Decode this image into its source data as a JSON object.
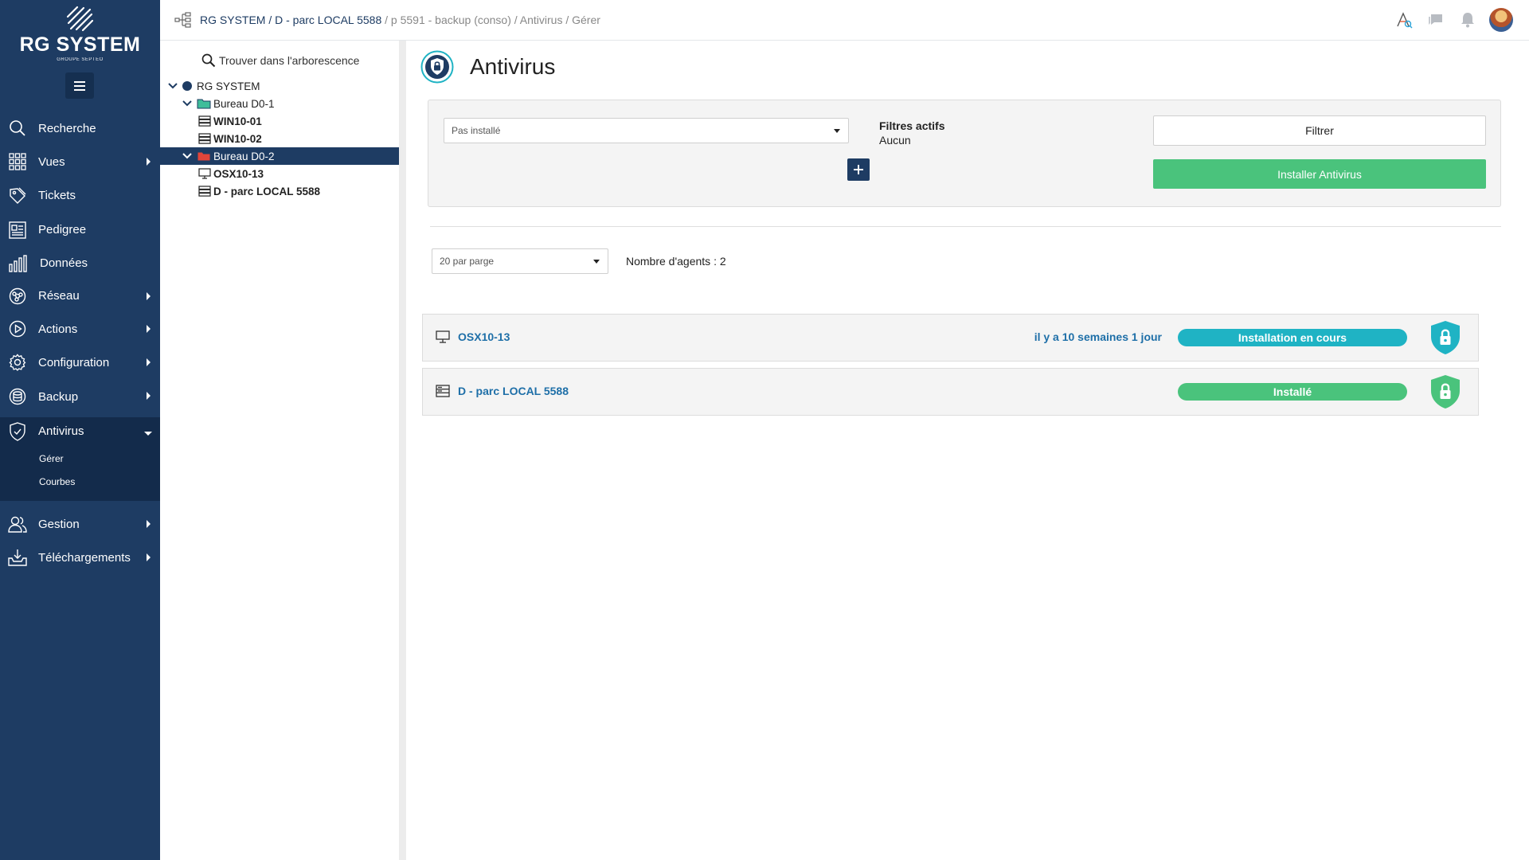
{
  "app": {
    "logo_text": "RG SYSTEM",
    "logo_sub": "GROUPE SEPTEO"
  },
  "sidebar": {
    "items": [
      {
        "label": "Recherche",
        "icon": "search-icon",
        "has_caret": false
      },
      {
        "label": "Vues",
        "icon": "grid-icon",
        "has_caret": true
      },
      {
        "label": "Tickets",
        "icon": "tag-icon",
        "has_caret": false
      },
      {
        "label": "Pedigree",
        "icon": "id-card-icon",
        "has_caret": false
      },
      {
        "label": "Données",
        "icon": "bar-chart-icon",
        "has_caret": false
      },
      {
        "label": "Réseau",
        "icon": "network-icon",
        "has_caret": true
      },
      {
        "label": "Actions",
        "icon": "play-icon",
        "has_caret": true
      },
      {
        "label": "Configuration",
        "icon": "gear-icon",
        "has_caret": true
      },
      {
        "label": "Backup",
        "icon": "database-icon",
        "has_caret": true
      },
      {
        "label": "Antivirus",
        "icon": "shield-check-icon",
        "has_caret": true,
        "active": true
      },
      {
        "label": "Gestion",
        "icon": "users-icon",
        "has_caret": true
      },
      {
        "label": "Téléchargements",
        "icon": "download-tray-icon",
        "has_caret": true
      }
    ],
    "antivirus_sub": [
      "Gérer",
      "Courbes"
    ]
  },
  "breadcrumb": {
    "part1": "RG SYSTEM / D - parc LOCAL 5588",
    "part2": " / p 5591 - backup (conso) / Antivirus / Gérer"
  },
  "tree": {
    "search_label": "Trouver dans l'arborescence",
    "nodes": [
      {
        "label": "RG SYSTEM",
        "depth": 0,
        "type": "root",
        "expanded": true
      },
      {
        "label": "Bureau D0-1",
        "depth": 1,
        "type": "folder-green",
        "expanded": true
      },
      {
        "label": "WIN10-01",
        "depth": 2,
        "type": "server"
      },
      {
        "label": "WIN10-02",
        "depth": 2,
        "type": "server"
      },
      {
        "label": "Bureau D0-2",
        "depth": 1,
        "type": "folder-red",
        "expanded": true,
        "selected": true
      },
      {
        "label": "OSX10-13",
        "depth": 2,
        "type": "monitor"
      },
      {
        "label": "D - parc LOCAL 5588",
        "depth": 2,
        "type": "server"
      }
    ]
  },
  "main": {
    "title": "Antivirus",
    "filter_select": "Pas installé",
    "active_filters_title": "Filtres actifs",
    "active_filters_value": "Aucun",
    "filter_button": "Filtrer",
    "install_button": "Installer Antivirus",
    "per_page": "20 par parge",
    "agents_count": "Nombre d'agents : 2",
    "agents": [
      {
        "name": "OSX10-13",
        "type": "monitor",
        "time": "il y a 10 semaines 1 jour",
        "status": "Installation en cours",
        "status_color": "#1fb3c4",
        "shield_color": "#1fb3c4"
      },
      {
        "name": "D - parc LOCAL 5588",
        "type": "server",
        "time": "",
        "status": "Installé",
        "status_color": "#4ac37c",
        "shield_color": "#4ac37c"
      }
    ]
  },
  "colors": {
    "sidebar": "#1e3c63",
    "accent_green": "#4ac37c",
    "accent_teal": "#1fb3c4",
    "link": "#1e6fa8"
  }
}
